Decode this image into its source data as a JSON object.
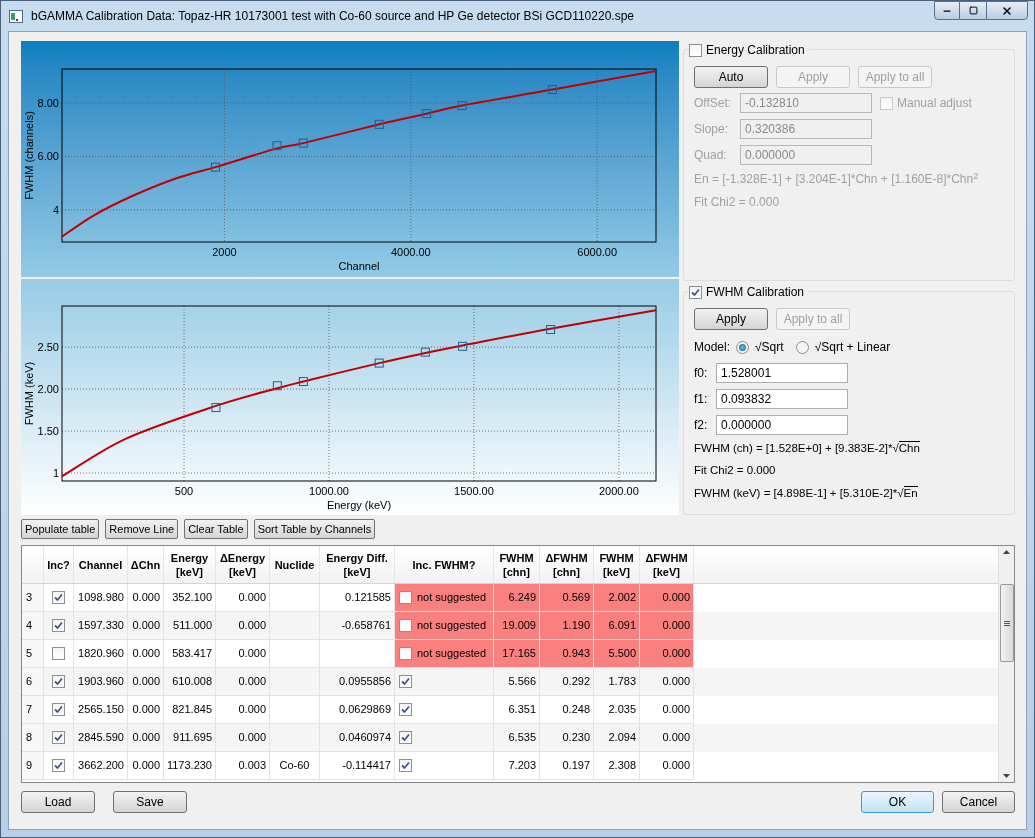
{
  "window": {
    "title": "bGAMMA Calibration Data: Topaz-HR 10173001 test with Co-60 source and HP Ge detector BSi GCD110220.spe"
  },
  "charts": [
    {
      "chart_data": {
        "type": "line",
        "xlabel": "Channel",
        "ylabel": "FWHM (channels)",
        "x": [
          257,
          600,
          1000,
          1500,
          1904,
          2565,
          2846,
          3662,
          4170,
          4550,
          5520,
          6631
        ],
        "series": [
          {
            "color": "#c00000",
            "values": [
              3.0,
              3.8,
              4.5,
              5.2,
              5.6,
              6.3,
              6.5,
              7.2,
              7.6,
              7.9,
              8.5,
              9.2
            ]
          },
          {
            "type": "scatter",
            "color": "#1f5f8f",
            "values": [
              null,
              null,
              null,
              null,
              5.6,
              6.4,
              6.5,
              7.2,
              7.6,
              7.9,
              8.5,
              null
            ]
          }
        ],
        "grid": true,
        "xlim": [
          257,
          6631
        ],
        "ylim": [
          2.8,
          9.27
        ],
        "xticks": [
          {
            "value": 2000,
            "label": "2000"
          },
          {
            "value": 4000,
            "label": "4000.00"
          },
          {
            "value": 6000,
            "label": "6000.00"
          }
        ],
        "yticks": [
          {
            "value": 4,
            "label": "4"
          },
          {
            "value": 6,
            "label": "6.00"
          },
          {
            "value": 8,
            "label": "8.00"
          }
        ]
      }
    },
    {
      "chart_data": {
        "type": "line",
        "xlabel": "Energy (keV)",
        "ylabel": "FWHM (keV)",
        "x": [
          79,
          300,
          610.008,
          821.845,
          911.695,
          1173.23,
          1332.5,
          1460.8,
          1764.5,
          2128
        ],
        "series": [
          {
            "color": "#c00000",
            "values": [
              0.96,
              1.41,
              1.8,
              2.01,
              2.09,
              2.31,
              2.43,
              2.52,
              2.72,
              2.94
            ]
          },
          {
            "type": "scatter",
            "color": "#1f5f8f",
            "values": [
              null,
              null,
              1.78,
              2.04,
              2.09,
              2.31,
              2.44,
              2.51,
              2.71,
              null
            ]
          }
        ],
        "grid": true,
        "xlim": [
          79,
          2128
        ],
        "ylim": [
          0.905,
          2.99
        ],
        "xticks": [
          {
            "value": 500,
            "label": "500"
          },
          {
            "value": 1000,
            "label": "1000.00"
          },
          {
            "value": 1500,
            "label": "1500.00"
          },
          {
            "value": 2000,
            "label": "2000.00"
          }
        ],
        "yticks": [
          {
            "value": 1,
            "label": "1"
          },
          {
            "value": 1.5,
            "label": "1.50"
          },
          {
            "value": 2,
            "label": "2.00"
          },
          {
            "value": 2.5,
            "label": "2.50"
          }
        ]
      }
    }
  ],
  "energy_calibration": {
    "label": "Energy Calibration",
    "checked": false,
    "buttons": [
      {
        "label": "Auto",
        "disabled": false
      },
      {
        "label": "Apply",
        "disabled": true
      },
      {
        "label": "Apply to all",
        "disabled": true
      }
    ],
    "fields": [
      {
        "label": "OffSet:",
        "value": "-0.132810"
      },
      {
        "label": "Slope:",
        "value": "0.320386"
      },
      {
        "label": "Quad:",
        "value": "0.000000"
      }
    ],
    "manual_adjust": {
      "label": "Manual adjust",
      "checked": false
    },
    "lines": [
      "En = [-1.328E-1] + [3.204E-1]*Chn + [1.160E-8]*Chn$^{2}$",
      "Fit Chi2 = 0.000"
    ]
  },
  "fwhm_calibration": {
    "label": "FWHM Calibration",
    "checked": true,
    "buttons": [
      {
        "label": "Apply",
        "disabled": false
      },
      {
        "label": "Apply to all",
        "disabled": true
      }
    ],
    "model": {
      "label": "Model:",
      "options": [
        {
          "label": "√Sqrt",
          "selected": true
        },
        {
          "label": "√Sqrt + Linear",
          "selected": false
        }
      ]
    },
    "fields": [
      {
        "label": "f0:",
        "value": "1.528001"
      },
      {
        "label": "f1:",
        "value": "0.093832"
      },
      {
        "label": "f2:",
        "value": "0.000000"
      }
    ],
    "lines": [
      {
        "text": "FWHM (ch) = [1.528E+0] + [9.383E-2]*√",
        "radicand": "Chn"
      },
      {
        "text": "Fit Chi2 = 0.000"
      },
      {
        "text": "FWHM (keV) = [4.898E-1] + [5.310E-2]*√",
        "radicand": "En"
      }
    ]
  },
  "table_buttons": [
    {
      "label": "Populate table"
    },
    {
      "label": "Remove Line"
    },
    {
      "label": "Clear Table"
    },
    {
      "label": "Sort Table by Channels"
    }
  ],
  "table": {
    "columns": [
      {
        "lines": [
          "Inc?"
        ]
      },
      {
        "lines": [
          "Channel"
        ]
      },
      {
        "lines": [
          "ΔChn"
        ]
      },
      {
        "lines": [
          "Energy",
          "[keV]"
        ]
      },
      {
        "lines": [
          "ΔEnergy",
          "[keV]"
        ]
      },
      {
        "lines": [
          "Nuclide"
        ]
      },
      {
        "lines": [
          "Energy Diff.",
          "[keV]"
        ]
      },
      {
        "lines": [
          "Inc. FWHM?"
        ]
      },
      {
        "lines": [
          "FWHM",
          "[chn]"
        ]
      },
      {
        "lines": [
          "ΔFWHM",
          "[chn]"
        ]
      },
      {
        "lines": [
          "FWHM",
          "[keV]"
        ]
      },
      {
        "lines": [
          "ΔFWHM",
          "[keV]"
        ]
      }
    ],
    "rows": [
      {
        "number": "3",
        "inc": true,
        "channel": "1098.980",
        "d_chn": "0.000",
        "energy": "352.100",
        "d_energy": "0.000",
        "energy_diff": "0.121585",
        "inc_fwhm": false,
        "note": "not suggested",
        "flagged": true,
        "fwhm_chn": "6.249",
        "d_fwhm_chn": "0.569",
        "fwhm_kev": "2.002",
        "d_fwhm_kev": "0.000"
      },
      {
        "number": "4",
        "inc": true,
        "channel": "1597.330",
        "d_chn": "0.000",
        "energy": "511.000",
        "d_energy": "0.000",
        "energy_diff": "-0.658761",
        "inc_fwhm": false,
        "note": "not suggested",
        "flagged": true,
        "fwhm_chn": "19.009",
        "d_fwhm_chn": "1.190",
        "fwhm_kev": "6.091",
        "d_fwhm_kev": "0.000"
      },
      {
        "number": "5",
        "inc": false,
        "channel": "1820.960",
        "d_chn": "0.000",
        "energy": "583.417",
        "d_energy": "0.000",
        "inc_fwhm": false,
        "note": "not suggested",
        "flagged": true,
        "fwhm_chn": "17.165",
        "d_fwhm_chn": "0.943",
        "fwhm_kev": "5.500",
        "d_fwhm_kev": "0.000"
      },
      {
        "number": "6",
        "inc": true,
        "channel": "1903.960",
        "d_chn": "0.000",
        "energy": "610.008",
        "d_energy": "0.000",
        "energy_diff": "0.0955856",
        "inc_fwhm": true,
        "flagged": false,
        "fwhm_chn": "5.566",
        "d_fwhm_chn": "0.292",
        "fwhm_kev": "1.783",
        "d_fwhm_kev": "0.000"
      },
      {
        "number": "7",
        "inc": true,
        "channel": "2565.150",
        "d_chn": "0.000",
        "energy": "821.845",
        "d_energy": "0.000",
        "energy_diff": "0.0629869",
        "inc_fwhm": true,
        "flagged": false,
        "fwhm_chn": "6.351",
        "d_fwhm_chn": "0.248",
        "fwhm_kev": "2.035",
        "d_fwhm_kev": "0.000"
      },
      {
        "number": "8",
        "inc": true,
        "channel": "2845.590",
        "d_chn": "0.000",
        "energy": "911.695",
        "d_energy": "0.000",
        "energy_diff": "0.0460974",
        "inc_fwhm": true,
        "flagged": false,
        "fwhm_chn": "6.535",
        "d_fwhm_chn": "0.230",
        "fwhm_kev": "2.094",
        "d_fwhm_kev": "0.000"
      },
      {
        "number": "9",
        "inc": true,
        "channel": "3662.200",
        "d_chn": "0.000",
        "energy": "1173.230",
        "d_energy": "0.003",
        "nuclide": "Co-60",
        "energy_diff": "-0.114417",
        "inc_fwhm": true,
        "flagged": false,
        "fwhm_chn": "7.203",
        "d_fwhm_chn": "0.197",
        "fwhm_kev": "2.308",
        "d_fwhm_kev": "0.000"
      }
    ]
  },
  "footer_buttons": [
    {
      "label": "Load"
    },
    {
      "label": "Save"
    }
  ],
  "dialog_buttons": [
    {
      "label": "OK",
      "focused": true
    },
    {
      "label": "Cancel",
      "focused": false
    }
  ]
}
